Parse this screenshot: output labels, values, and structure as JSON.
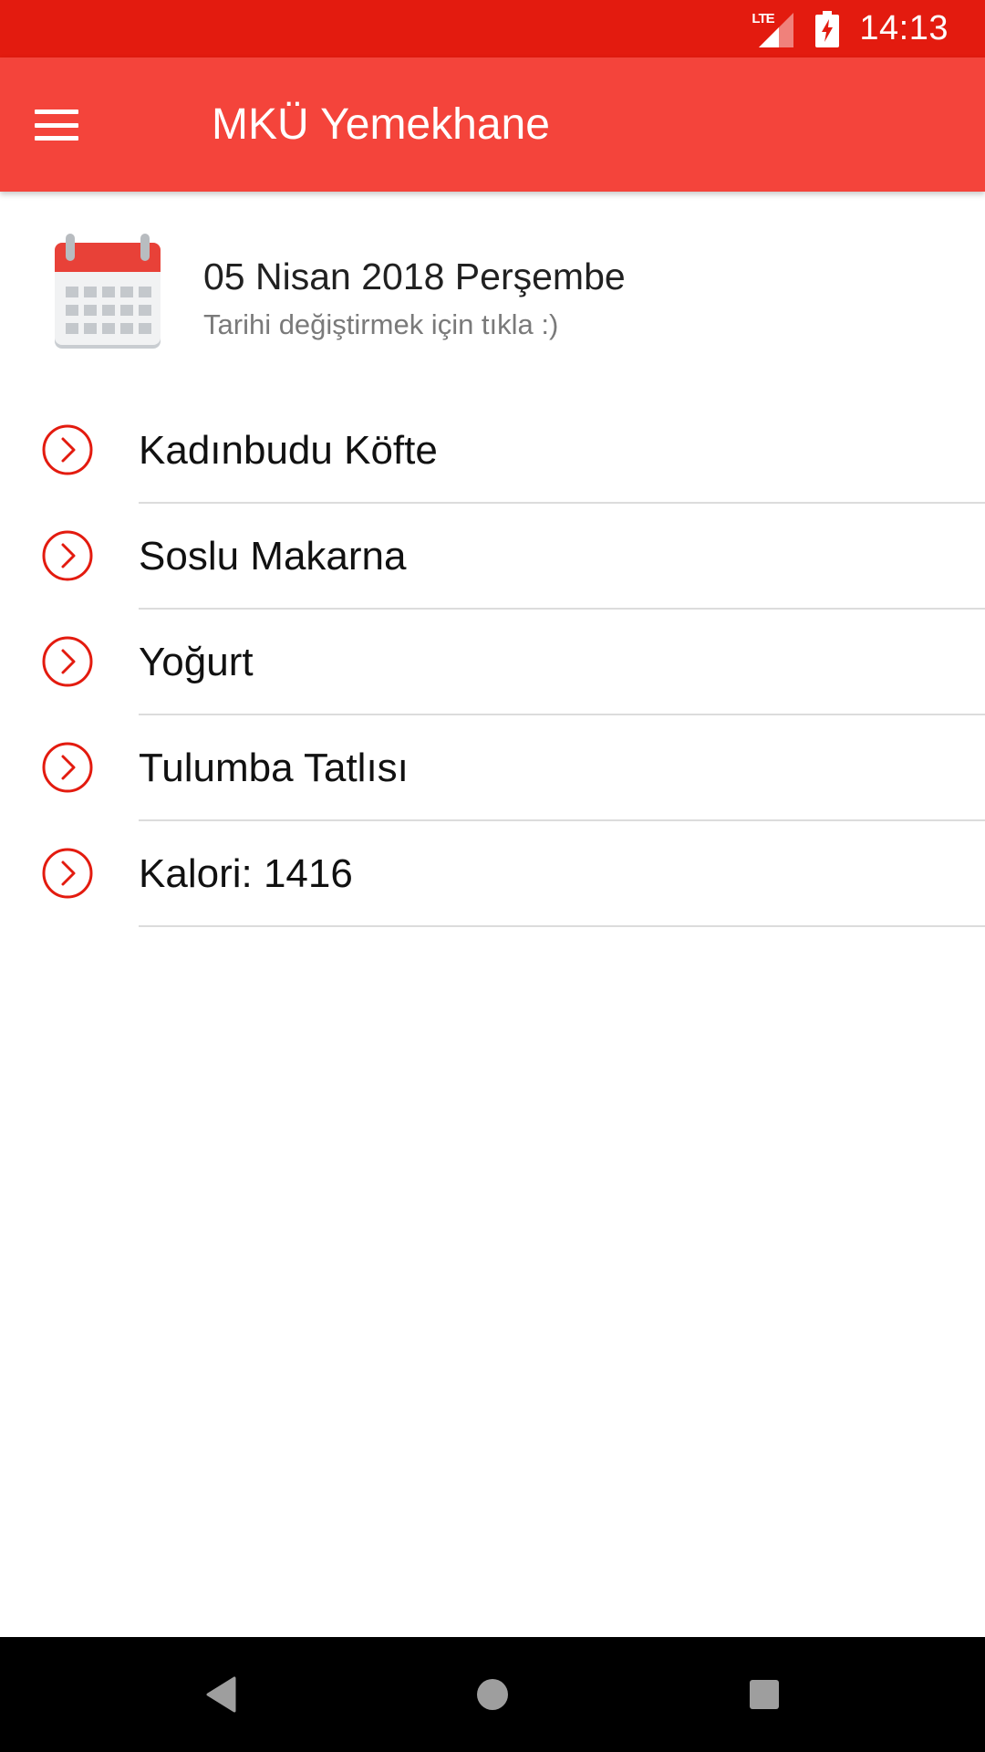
{
  "status_bar": {
    "network_label": "LTE",
    "time": "14:13",
    "background_color": "#e31b0f"
  },
  "app_bar": {
    "title": "MKÜ Yemekhane",
    "menu_icon": "hamburger-menu-icon",
    "background_color": "#f4443b"
  },
  "date_header": {
    "icon": "calendar-icon",
    "date": "05 Nisan 2018 Perşembe",
    "hint": "Tarihi değiştirmek için tıkla :)"
  },
  "menu": {
    "items": [
      {
        "label": "Kadınbudu Köfte",
        "icon": "chevron-circle-right-icon"
      },
      {
        "label": "Soslu Makarna",
        "icon": "chevron-circle-right-icon"
      },
      {
        "label": "Yoğurt",
        "icon": "chevron-circle-right-icon"
      },
      {
        "label": "Tulumba Tatlısı",
        "icon": "chevron-circle-right-icon"
      },
      {
        "label": "Kalori: 1416",
        "icon": "chevron-circle-right-icon"
      }
    ],
    "accent_color": "#e31b0f"
  },
  "nav_bar": {
    "back_icon": "back-triangle-icon",
    "home_icon": "home-circle-icon",
    "recent_icon": "recents-square-icon"
  }
}
